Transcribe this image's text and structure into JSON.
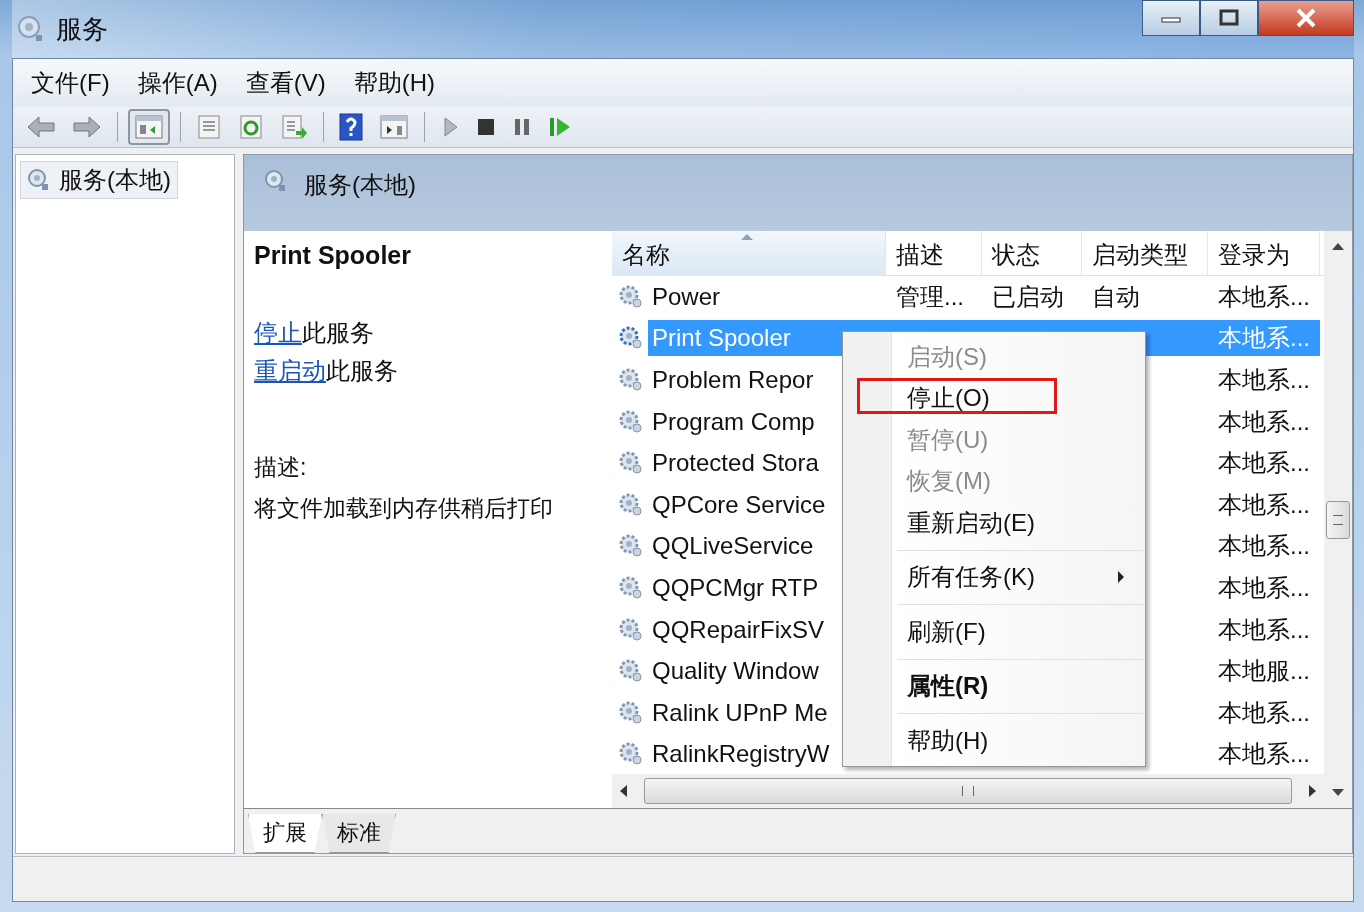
{
  "window": {
    "title": "服务"
  },
  "menu_bar": [
    "文件(F)",
    "操作(A)",
    "查看(V)",
    "帮助(H)"
  ],
  "tree": {
    "items": [
      {
        "label": "服务(本地)",
        "selected": true
      }
    ]
  },
  "pane": {
    "title": "服务(本地)"
  },
  "details": {
    "service_name": "Print Spooler",
    "actions": [
      {
        "link": "停止",
        "text": "此服务"
      },
      {
        "link": "重启动",
        "text": "此服务"
      }
    ],
    "description_label": "描述:",
    "description": "将文件加载到内存供稍后打印"
  },
  "table": {
    "columns": [
      {
        "label": "名称",
        "sorted": true
      },
      {
        "label": "描述",
        "sorted": false
      },
      {
        "label": "状态",
        "sorted": false
      },
      {
        "label": "启动类型",
        "sorted": false
      },
      {
        "label": "登录为",
        "sorted": false
      }
    ],
    "rows": [
      {
        "name": "Power",
        "description": "管理...",
        "status": "已启动",
        "startup": "自动",
        "logon": "本地系...",
        "selected": false
      },
      {
        "name": "Print Spooler",
        "logon": "本地系...",
        "selected": true
      },
      {
        "name": "Problem Repor",
        "logon": "本地系...",
        "selected": false
      },
      {
        "name": "Program Comp",
        "logon": "本地系...",
        "selected": false
      },
      {
        "name": "Protected Stora",
        "logon": "本地系...",
        "selected": false
      },
      {
        "name": "QPCore Service",
        "logon": "本地系...",
        "selected": false
      },
      {
        "name": "QQLiveService",
        "logon": "本地系...",
        "selected": false
      },
      {
        "name": "QQPCMgr RTP",
        "logon": "本地系...",
        "selected": false
      },
      {
        "name": "QQRepairFixSV",
        "logon": "本地系...",
        "selected": false
      },
      {
        "name": "Quality Window",
        "logon": "本地服...",
        "selected": false
      },
      {
        "name": "Ralink UPnP Me",
        "logon": "本地系...",
        "selected": false
      },
      {
        "name": "RalinkRegistryW",
        "logon": "本地系...",
        "selected": false
      }
    ]
  },
  "context_menu": {
    "items": [
      {
        "kind": "item",
        "label": "启动(S)",
        "disabled": true,
        "bold": false,
        "submenu": false,
        "outlined": false
      },
      {
        "kind": "item",
        "label": "停止(O)",
        "disabled": false,
        "bold": false,
        "submenu": false,
        "outlined": true
      },
      {
        "kind": "item",
        "label": "暂停(U)",
        "disabled": true,
        "bold": false,
        "submenu": false,
        "outlined": false
      },
      {
        "kind": "item",
        "label": "恢复(M)",
        "disabled": true,
        "bold": false,
        "submenu": false,
        "outlined": false
      },
      {
        "kind": "item",
        "label": "重新启动(E)",
        "disabled": false,
        "bold": false,
        "submenu": false,
        "outlined": false
      },
      {
        "kind": "separator"
      },
      {
        "kind": "item",
        "label": "所有任务(K)",
        "disabled": false,
        "bold": false,
        "submenu": true,
        "outlined": false
      },
      {
        "kind": "separator"
      },
      {
        "kind": "item",
        "label": "刷新(F)",
        "disabled": false,
        "bold": false,
        "submenu": false,
        "outlined": false
      },
      {
        "kind": "separator"
      },
      {
        "kind": "item",
        "label": "属性(R)",
        "disabled": false,
        "bold": true,
        "submenu": false,
        "outlined": false
      },
      {
        "kind": "separator"
      },
      {
        "kind": "item",
        "label": "帮助(H)",
        "disabled": false,
        "bold": false,
        "submenu": false,
        "outlined": false
      }
    ]
  },
  "tabs": [
    {
      "label": "扩展",
      "selected": true
    },
    {
      "label": "标准",
      "selected": false
    }
  ]
}
